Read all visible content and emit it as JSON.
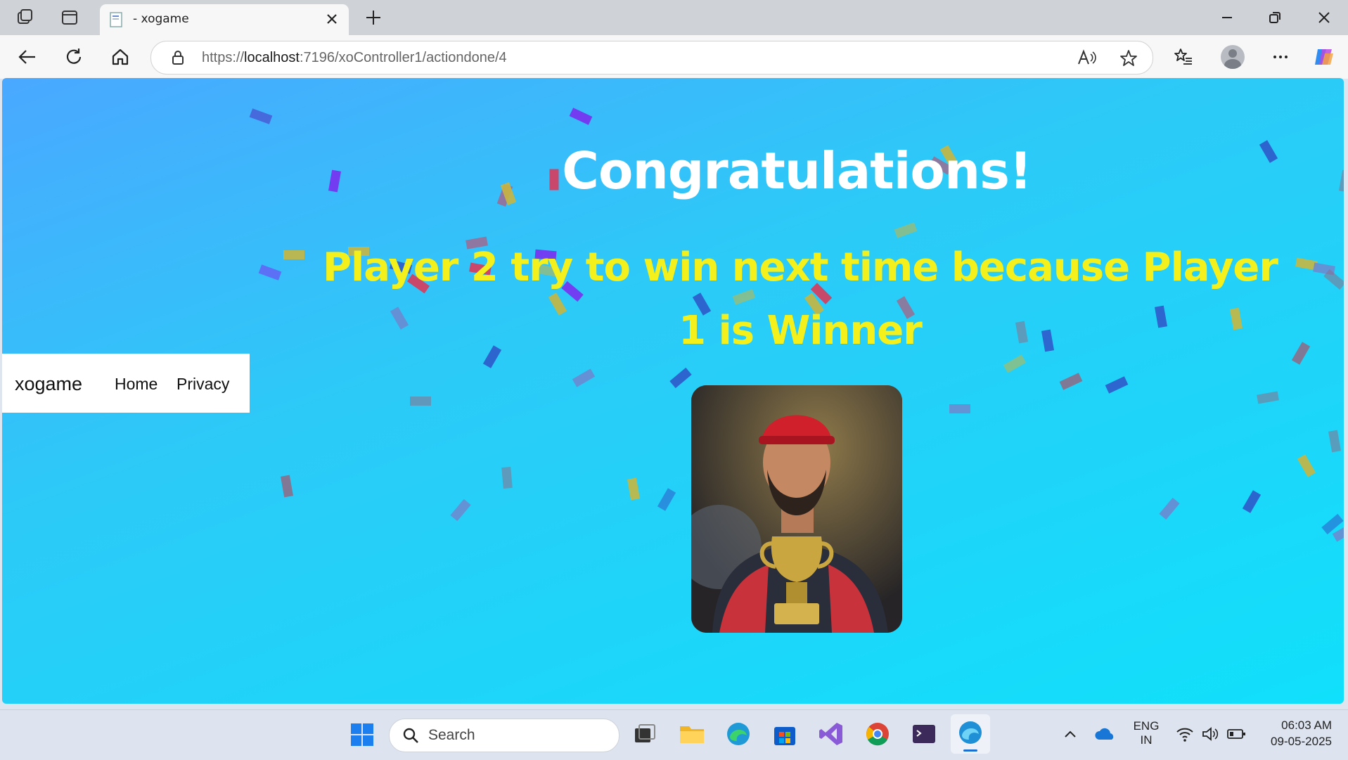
{
  "browser": {
    "tab_title": "- xogame",
    "url_prefix": "https://",
    "url_host": "localhost",
    "url_rest": ":7196/xoController1/actiondone/4"
  },
  "site": {
    "brand": "xogame",
    "nav": [
      "Home",
      "Privacy"
    ]
  },
  "page": {
    "heading": "Congratulations!",
    "message": "Player 2 try to win next time because Player 1 is Winner",
    "heading_color": "#ffffff",
    "message_color": "#f4f01c"
  },
  "taskbar": {
    "search_placeholder": "Search",
    "language_line1": "ENG",
    "language_line2": "IN",
    "time": "06:03 AM",
    "date": "09-05-2025"
  },
  "colors": {
    "gradient_start": "#4aa8ff",
    "gradient_end": "#10e0fb",
    "confetti": [
      "#4a2dbf",
      "#7a2ff0",
      "#d93a5a",
      "#c8b640",
      "#2e5ac9",
      "#8a6f8a",
      "#6a8bd0"
    ]
  }
}
